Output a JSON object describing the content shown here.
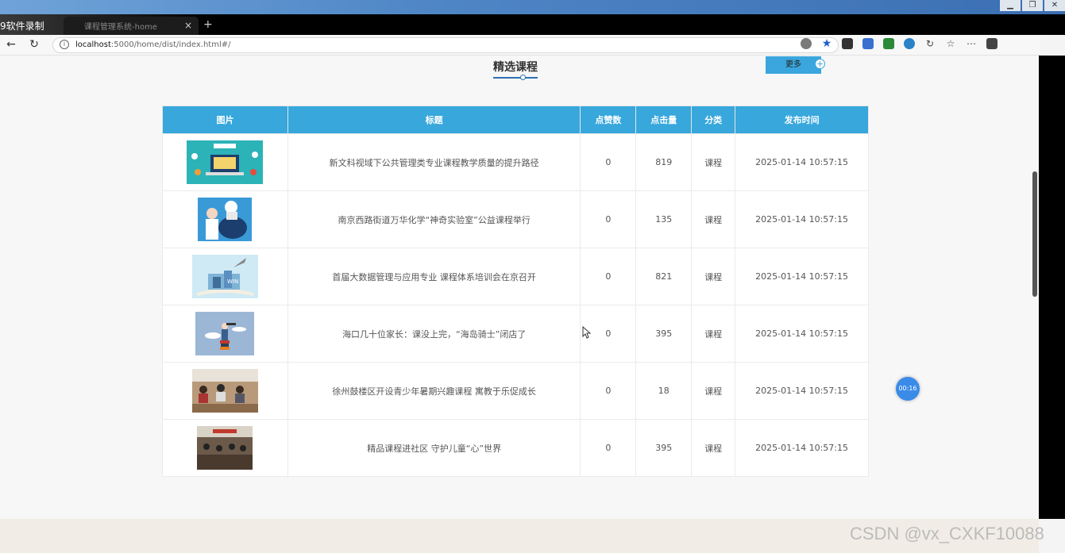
{
  "window": {
    "recorder_label": "9软件录制",
    "tab_title": "课程管理系统-home",
    "tab_close": "×",
    "tab_new": "+"
  },
  "addressbar": {
    "url_host": "localhost",
    "url_path": ":5000/home/dist/index.html#/"
  },
  "page": {
    "section_title": "精选课程",
    "more_label": "更多",
    "more_plus": "+"
  },
  "table": {
    "headers": [
      "图片",
      "标题",
      "点赞数",
      "点击量",
      "分类",
      "发布时间"
    ],
    "rows": [
      {
        "title": "新文科视域下公共管理类专业课程教学质量的提升路径",
        "likes": "0",
        "clicks": "819",
        "category": "课程",
        "time": "2025-01-14 10:57:15"
      },
      {
        "title": "南京西路街道万华化学“神奇实验室”公益课程举行",
        "likes": "0",
        "clicks": "135",
        "category": "课程",
        "time": "2025-01-14 10:57:15"
      },
      {
        "title": "首届大数据管理与应用专业 课程体系培训会在京召开",
        "likes": "0",
        "clicks": "821",
        "category": "课程",
        "time": "2025-01-14 10:57:15"
      },
      {
        "title": "海口几十位家长：课没上完，“海岛骑士”闭店了",
        "likes": "0",
        "clicks": "395",
        "category": "课程",
        "time": "2025-01-14 10:57:15"
      },
      {
        "title": "徐州鼓楼区开设青少年暑期兴趣课程 寓教于乐促成长",
        "likes": "0",
        "clicks": "18",
        "category": "课程",
        "time": "2025-01-14 10:57:15"
      },
      {
        "title": "精品课程进社区 守护儿童“心”世界",
        "likes": "0",
        "clicks": "395",
        "category": "课程",
        "time": "2025-01-14 10:57:15"
      }
    ]
  },
  "overlay": {
    "timer": "00:16",
    "watermark": "CSDN @vx_CXKF10088"
  },
  "colors": {
    "header_bg": "#37a7dc",
    "accent": "#2f6fb0"
  }
}
